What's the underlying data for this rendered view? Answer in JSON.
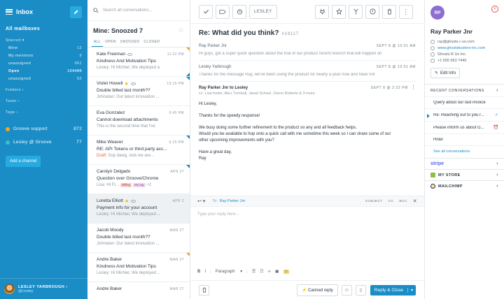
{
  "sidebar": {
    "title": "Inbox",
    "all_mailboxes": "All mailboxes",
    "starred_label": "Starred",
    "starred_items": [
      {
        "label": "Mine",
        "count": "12"
      },
      {
        "label": "My mentions",
        "count": "9"
      },
      {
        "label": "unassigned",
        "count": "961"
      },
      {
        "label": "Open",
        "count": "104489"
      },
      {
        "label": "unassigned",
        "count": "52"
      }
    ],
    "folders_label": "Folders",
    "team_label": "Team",
    "tags_label": "Tags",
    "mailboxes": [
      {
        "label": "Groove support",
        "count": "872",
        "color": "#f5a623"
      },
      {
        "label": "Lesley @ Groove",
        "count": "77",
        "color": "#3bc0c8"
      }
    ],
    "add_channel": "Add a channel",
    "user_name": "LESLEY YARBROUGH",
    "user_handle": "@Lesley"
  },
  "list": {
    "search_placeholder": "Search all conversations...",
    "title": "Mine: Snoozed 7",
    "tabs": [
      "ALL",
      "OPEN",
      "SNOOZED",
      "CLOSED"
    ],
    "items": [
      {
        "name": "Kate Freeman",
        "time": "11:22 PM",
        "subject": "Kindness And Motivation Tips",
        "preview": "Lesley: Hi Michiel, We deployed a",
        "draft": "",
        "star": false,
        "tags": []
      },
      {
        "name": "Violet Howell",
        "time": "10:15 PM",
        "subject": "Double billed last month??",
        "preview": "Johnatan: Our latest innovation ...",
        "draft": "",
        "star": true,
        "tags": []
      },
      {
        "name": "Eva Gonzalez",
        "time": "9:45 PM",
        "subject": "Cannot download attachments",
        "preview": "This is the second time that I've",
        "draft": "",
        "star": false,
        "tags": []
      },
      {
        "name": "Mike Weaver",
        "time": "6:15 PM",
        "subject": "RE: API Tokens or third party acc...",
        "preview": " Sup dawg, look we are...",
        "draft": "Draft:",
        "star": false,
        "tags": []
      },
      {
        "name": "Carolyn Delgado",
        "time": "APR 27",
        "subject": "Question over Groove/Chrome",
        "preview": "Lisa: Hi Fr...",
        "draft": "",
        "star": false,
        "tags": [
          "Billing",
          "My tag",
          "+2"
        ]
      },
      {
        "name": "Loretta Elliott",
        "time": "APR 2",
        "subject": "Payment info for your account",
        "preview": "Lesley: Hi Michiel, We deployed ...",
        "draft": "",
        "star": true,
        "tags": []
      },
      {
        "name": "Jacob Moody",
        "time": "MAR 27",
        "subject": "Double billed last month??",
        "preview": "Johnatan: Our latest innovation ...",
        "draft": "",
        "star": false,
        "tags": []
      },
      {
        "name": "Andre Baker",
        "time": "MAR 27",
        "subject": "Kindness And Motivation Tips",
        "preview": "Lesley: Hi Michiel, We deployed ...",
        "draft": "",
        "star": false,
        "tags": []
      },
      {
        "name": "Andre Baker",
        "time": "MAR 27",
        "subject": "",
        "preview": "",
        "draft": "",
        "star": false,
        "tags": []
      }
    ]
  },
  "toolbar": {
    "label_btn": "LESLEY"
  },
  "ticket": {
    "subject": "Re: What did you think?",
    "id": "#19117",
    "messages": [
      {
        "from": "Ray Parker Jnr",
        "date": "SEPT 8 @ 10:51 AM",
        "snippet": "Hi guys, got a super quick question about the trial of our product recent relunch that will happen on"
      },
      {
        "from": "Lesley Yarbrough",
        "date": "SEPT 8 @ 10:51 AM",
        "snippet": "Thanks for the message Ray, we've been using the product for nearly a year now and have not"
      }
    ],
    "full": {
      "from": "Ray Parker Jnr to Lesley",
      "date": "SEPT 8 @ 2:22 PM",
      "cc": "cc: Lisa foster, Alex Turnbull, Jarad Scheel, Glenn Roberts & 3 more",
      "body": [
        "Hi Lesley,",
        "",
        "Thanks for the speedy response!",
        "",
        "We busy doing some further refinement to the product so any and all feedback helps.",
        "Would you be available to hop onto a quick call with me sometime this week so I can share some of our",
        "other upcoming improvements with you?",
        "",
        "Have a great day,",
        "Ray"
      ]
    }
  },
  "reply": {
    "to_label": "To:",
    "recipient": "Ray Parker Jnr",
    "options": [
      "SUBJECT",
      "CC",
      "BCC"
    ],
    "placeholder": "Type your reply here...",
    "format_label": "Paragraph",
    "canned": "Canned reply",
    "send": "Reply & Close"
  },
  "contact": {
    "initials": "RP",
    "name": "Ray Parker Jnr",
    "email": "ray@ghosts-r-us.com",
    "website": "www.ghostsbusters-inc.com",
    "company": "Ghosts R Us Inc.",
    "phone": "+1 555 563 7440",
    "edit": "Edit Info",
    "recent_label": "RECENT CONVERSATIONS",
    "recent": [
      "Query about our last invoice",
      "Re: Reaching out to you r...",
      "Please inform us about G...",
      "Hola!"
    ],
    "see_all": "See all conversations",
    "integrations": [
      "stripe",
      "MY STORE",
      "MAILCHIMP"
    ]
  }
}
